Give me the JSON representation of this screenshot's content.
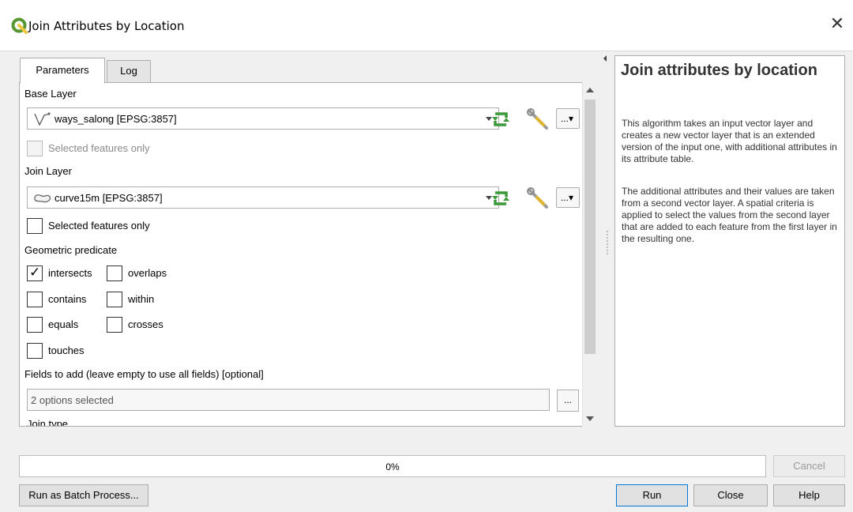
{
  "window": {
    "title": "Join Attributes by Location",
    "close_glyph": "✕",
    "app_icon": "qgis-logo-icon"
  },
  "tabs": [
    {
      "label": "Parameters",
      "active": true
    },
    {
      "label": "Log",
      "active": false
    }
  ],
  "params": {
    "base_layer": {
      "label": "Base Layer",
      "value": "ways_salong [EPSG:3857]",
      "icon": "line-layer-icon",
      "selected_only_label": "Selected features only",
      "selected_only_checked": false,
      "selected_only_enabled": false
    },
    "join_layer": {
      "label": "Join Layer",
      "value": "curve15m [EPSG:3857]",
      "icon": "polygon-layer-icon",
      "selected_only_label": "Selected features only",
      "selected_only_checked": false,
      "selected_only_enabled": true
    },
    "ellipsis_dropdown_label": "...▾",
    "predicate": {
      "label": "Geometric predicate",
      "options": [
        {
          "label": "intersects",
          "checked": true
        },
        {
          "label": "overlaps",
          "checked": false
        },
        {
          "label": "contains",
          "checked": false
        },
        {
          "label": "within",
          "checked": false
        },
        {
          "label": "equals",
          "checked": false
        },
        {
          "label": "crosses",
          "checked": false
        },
        {
          "label": "touches",
          "checked": false
        }
      ]
    },
    "fields": {
      "label": "Fields to add (leave empty to use all fields) [optional]",
      "value": "2 options selected",
      "button_label": "..."
    },
    "join_type_label": "Join type"
  },
  "help": {
    "title": "Join attributes by location",
    "paragraph1": "This algorithm takes an input vector layer and creates a new vector layer that is an extended version of the input one, with additional attributes in its attribute table.",
    "paragraph2": "The additional attributes and their values are taken from a second vector layer. A spatial criteria is applied to select the values from the second layer that are added to each feature from the first layer in the resulting one."
  },
  "progress": {
    "value": 0,
    "text": "0%"
  },
  "buttons": {
    "cancel": "Cancel",
    "batch": "Run as Batch Process...",
    "run": "Run",
    "close": "Close",
    "help": "Help"
  },
  "colors": {
    "accent": "#0078d7",
    "iterate_icon": "#3a9a3a",
    "qgis_green": "#589632",
    "qgis_yellow": "#f0c83c"
  }
}
